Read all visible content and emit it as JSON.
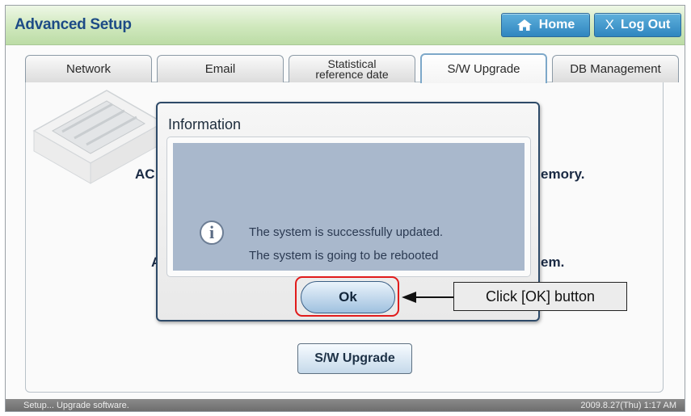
{
  "header": {
    "title": "Advanced Setup",
    "home_label": "Home",
    "logout_x": "X",
    "logout_label": "Log Out"
  },
  "tabs": [
    {
      "label": "Network"
    },
    {
      "label": "Email"
    },
    {
      "label_line1": "Statistical",
      "label_line2": "reference date"
    },
    {
      "label": "S/W Upgrade",
      "active": true
    },
    {
      "label": "DB Management"
    }
  ],
  "background_text": {
    "ac_fragment": "AC",
    "memory_fragment": "emory.",
    "a_fragment": "A",
    "em_fragment": "em."
  },
  "dialog": {
    "title": "Information",
    "message_line1": "The system is successfully updated.",
    "message_line2": "The system is going to be rebooted",
    "ok_label": "Ok",
    "info_icon_glyph": "i"
  },
  "annotation": {
    "callout_text": "Click [OK] button",
    "highlight_color": "#e11b1b"
  },
  "main": {
    "upgrade_button_label": "S/W Upgrade"
  },
  "status": {
    "left_text": "Setup... Upgrade software.",
    "right_text": "2009.8.27(Thu)  1:17 AM"
  }
}
